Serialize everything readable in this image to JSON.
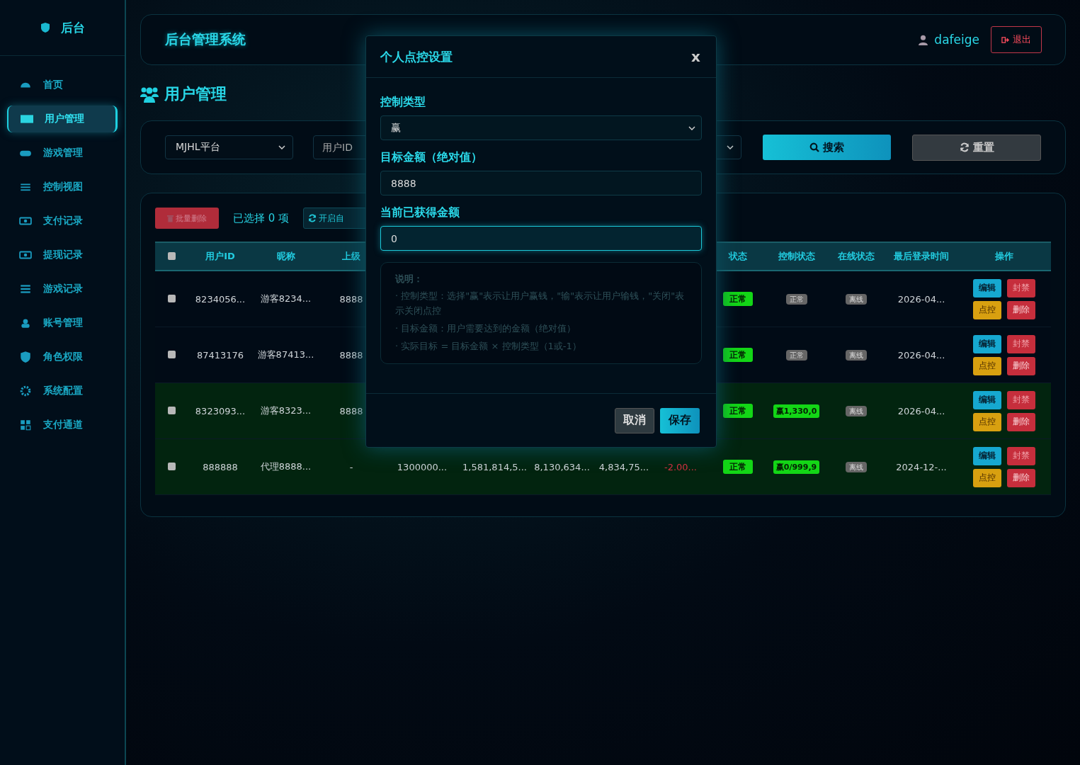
{
  "sidebar": {
    "logo": "后台",
    "items": [
      {
        "label": "首页",
        "selected": false
      },
      {
        "label": "用户管理",
        "selected": true
      },
      {
        "label": "游戏管理",
        "selected": false
      },
      {
        "label": "控制视图",
        "selected": false
      },
      {
        "label": "支付记录",
        "selected": false
      },
      {
        "label": "提现记录",
        "selected": false
      },
      {
        "label": "游戏记录",
        "selected": false
      },
      {
        "label": "账号管理",
        "selected": false
      },
      {
        "label": "角色权限",
        "selected": false
      },
      {
        "label": "系统配置",
        "selected": false
      },
      {
        "label": "支付通道",
        "selected": false
      }
    ]
  },
  "header": {
    "title": "后台管理系统",
    "user": "dafeige",
    "logout": "退出"
  },
  "page_title": "用户管理",
  "filters": {
    "platform": "MJHL平台",
    "user_id_placeholder": "用户ID",
    "search": "搜索",
    "reset": "重置"
  },
  "toolbar": {
    "batch_delete": "批量删除",
    "selected_count": "已选择 0 项",
    "auto_button": "开启自"
  },
  "table": {
    "select_all": false,
    "columns": [
      "用户ID",
      "昵称",
      "上级",
      "状态",
      "控制状态",
      "在线状态",
      "最后登录时间",
      "操作"
    ],
    "rows": [
      {
        "selected": false,
        "highlighted": false,
        "user_id": "8234056...",
        "nickname": "游客8234...",
        "parent": "8888",
        "amounts": [],
        "status": "正常",
        "control": {
          "kind": "plain",
          "text": "正常"
        },
        "online": "离线",
        "last_login": "2026-04...",
        "actions": [
          "编辑",
          "封禁",
          "点控",
          "删除"
        ]
      },
      {
        "selected": false,
        "highlighted": false,
        "user_id": "87413176",
        "nickname": "游客87413...",
        "parent": "8888",
        "amounts": [],
        "status": "正常",
        "control": {
          "kind": "plain",
          "text": "正常"
        },
        "online": "离线",
        "last_login": "2026-04...",
        "actions": [
          "编辑",
          "封禁",
          "点控",
          "删除"
        ]
      },
      {
        "selected": false,
        "highlighted": true,
        "user_id": "8323093...",
        "nickname": "游客8323...",
        "parent": "8888",
        "amounts": [],
        "status": "正常",
        "control": {
          "kind": "active",
          "text": "赢1,330,0"
        },
        "online": "离线",
        "last_login": "2026-04...",
        "actions": [
          "编辑",
          "封禁",
          "点控",
          "删除"
        ]
      },
      {
        "selected": false,
        "highlighted": true,
        "user_id": "888888",
        "nickname": "代理8888...",
        "parent": "-",
        "amounts": [
          {
            "text": "1300000...",
            "negative": false
          },
          {
            "text": "1,581,814,5...",
            "negative": false
          },
          {
            "text": "8,130,634...",
            "negative": false
          },
          {
            "text": "4,834,75...",
            "negative": false
          },
          {
            "text": "-2.00...",
            "negative": true
          }
        ],
        "status": "正常",
        "control": {
          "kind": "active",
          "text": "赢0/999,9"
        },
        "online": "离线",
        "last_login": "2024-12-...",
        "actions": [
          "编辑",
          "封禁",
          "点控",
          "删除"
        ]
      }
    ]
  },
  "modal": {
    "title": "个人点控设置",
    "close": "x",
    "fields": [
      {
        "kind": "select",
        "label": "控制类型",
        "value": "赢",
        "focused": false
      },
      {
        "kind": "input",
        "label": "目标金额（绝对值）",
        "value": "8888",
        "focused": false
      },
      {
        "kind": "input",
        "label": "当前已获得金额",
        "value": "0",
        "focused": true
      }
    ],
    "notes": {
      "title": "说明：",
      "lines": [
        "· 控制类型：选择\"赢\"表示让用户赢钱，\"输\"表示让用户输钱，\"关闭\"表示关闭点控",
        "· 目标金额：用户需要达到的金额（绝对值）",
        "· 实际目标 = 目标金额 × 控制类型（1或-1）"
      ]
    },
    "cancel": "取消",
    "save": "保存"
  }
}
